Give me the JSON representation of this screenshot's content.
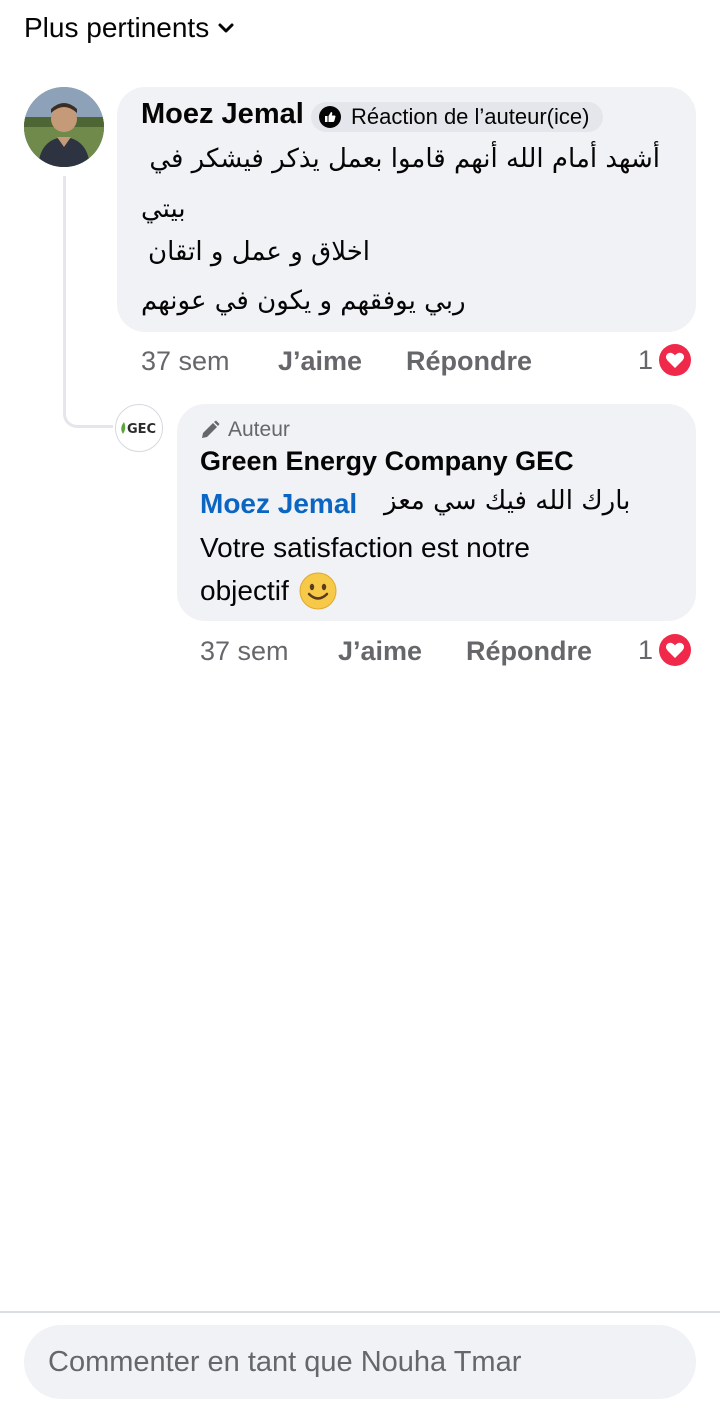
{
  "sort": {
    "label": "Plus pertinents"
  },
  "comment": {
    "author": "Moez Jemal",
    "badge": "Réaction de l’auteur(ice)",
    "lines": [
      "أشهد أمام الله أنهم قاموا بعمل يذكر فيشكر في",
      "بيتي",
      "اخلاق و عمل و اتقان",
      "ربي يوفقهم و يكون في عونهم"
    ],
    "time": "37 sem",
    "like_label": "J’aime",
    "reply_label": "Répondre",
    "reaction_count": "1"
  },
  "reply": {
    "author_tag": "Auteur",
    "author": "Green Energy Company GEC",
    "avatar_text": "GEC",
    "mention": "Moez Jemal",
    "arabic_text": "بارك الله فيك سي معز",
    "text_line2": "Votre satisfaction est notre",
    "text_line3": "objectif",
    "time": "37 sem",
    "like_label": "J’aime",
    "reply_label": "Répondre",
    "reaction_count": "1"
  },
  "composer": {
    "placeholder": "Commenter en tant que Nouha Tmar"
  },
  "colors": {
    "link": "#0a66c2",
    "heart": "#f02849",
    "bubble": "#f0f2f5"
  }
}
